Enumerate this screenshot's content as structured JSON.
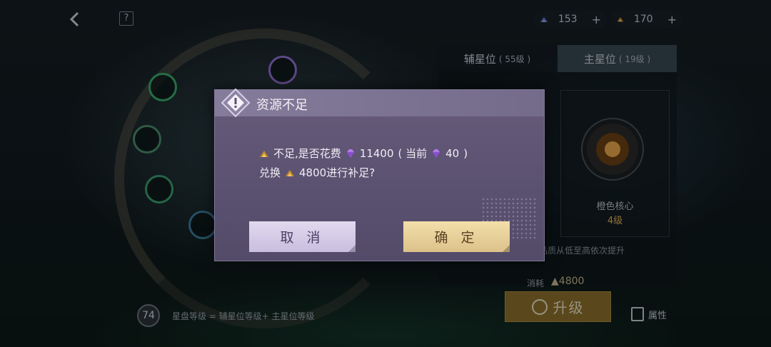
{
  "top_bar": {
    "back_icon": "chevron-left-icon",
    "help_label": "?",
    "currency_blue": {
      "value": "153",
      "plus": "+"
    },
    "currency_gold": {
      "value": "170",
      "plus": "+"
    }
  },
  "tabs": [
    {
      "label": "辅星位",
      "level": "( 55级 )"
    },
    {
      "label": "主星位",
      "level": "( 19级 )"
    }
  ],
  "core": {
    "name": "橙色核心",
    "level": "4级",
    "quality_text": "品质从低至高依次提升"
  },
  "cost": {
    "label": "消耗",
    "value": "4800"
  },
  "upgrade_button": "升级",
  "attr_button": "属性",
  "star_disk": {
    "level": "74",
    "formula": "星盘等级 = 辅星位等级+ 主星位等级"
  },
  "dialog": {
    "title": "资源不足",
    "line1_a": "不足,是否花费",
    "line1_amount": "11400",
    "line1_b": "( 当前",
    "line1_current": "40",
    "line1_c": ")",
    "line2_a": "兑换",
    "line2_b": "4800进行补足?",
    "cancel": "取 消",
    "confirm": "确 定"
  },
  "colors": {
    "dialog_bg": "#5a5070",
    "cancel_bg": "#d6cce8",
    "confirm_bg": "#e8d198",
    "gold": "#e0b25a",
    "gem": "#b07be8"
  }
}
